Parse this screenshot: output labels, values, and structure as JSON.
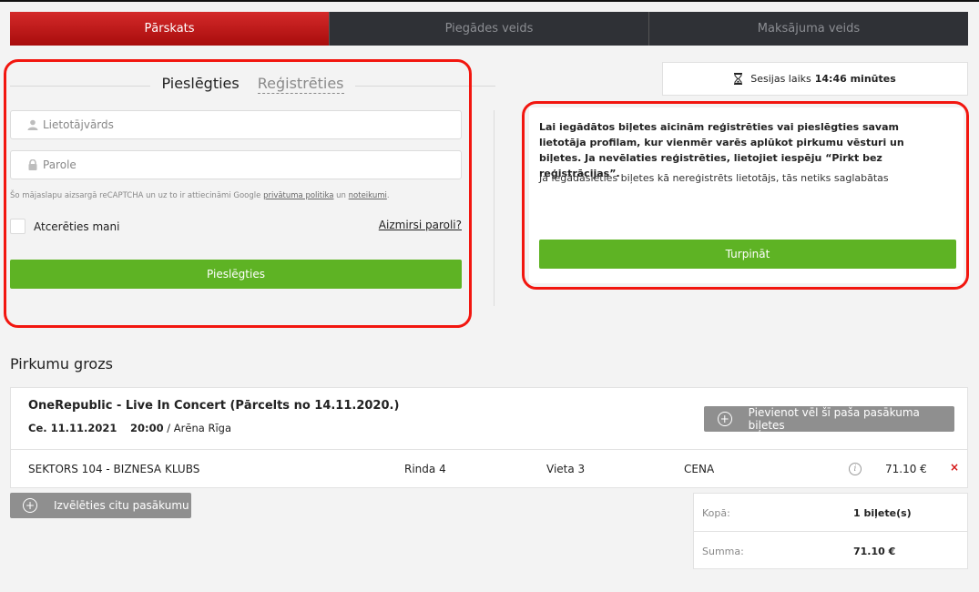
{
  "steps": [
    {
      "label": "Pārskats",
      "active": true
    },
    {
      "label": "Piegādes veids",
      "active": false
    },
    {
      "label": "Maksājuma veids",
      "active": false
    }
  ],
  "login": {
    "tab_login": "Pieslēgties",
    "tab_register": "Reģistrēties",
    "username_placeholder": "Lietotājvārds",
    "password_placeholder": "Parole",
    "recaptcha_text": "Šo mājaslapu aizsargā reCAPTCHA un uz to ir attiecināmi Google",
    "privacy_link": "privātuma politika",
    "and_text": "un",
    "terms_link": "noteikumi",
    "period": ".",
    "remember_label": "Atcerēties mani",
    "forgot_link": "Aizmirsi paroli?",
    "login_button": "Pieslēgties"
  },
  "session": {
    "label": "Sesijas laiks",
    "time": "14:46 minūtes",
    "icon": "hourglass-icon"
  },
  "info": {
    "bold_text": "Lai iegādātos biļetes aicinām reģistrēties vai pieslēgties savam lietotāja profilam, kur vienmēr varēs aplūkot pirkumu vēsturi un biļetes. Ja nevēlaties reģistrēties, lietojiet iespēju “Pirkt bez reģistrācijas”.",
    "normal_text": "Ja iegādāsieties biļetes kā nereģistrēts lietotājs, tās netiks saglabātas",
    "continue_button": "Turpināt"
  },
  "cart": {
    "title": "Pirkumu grozs",
    "event": {
      "name": "OneRepublic - Live In Concert (Pārcelts no 14.11.2020.)",
      "date": "Ce. 11.11.2021",
      "time": "20:00",
      "venue": "/ Arēna Rīga",
      "add_button": "Pievienot vēl šī paša pasākuma biļetes"
    },
    "tickets": [
      {
        "sector": "SEKTORS 104 - BIZNESA KLUBS",
        "row": "Rinda 4",
        "seat": "Vieta 3",
        "price_label": "CENA",
        "price": "71.10 €",
        "remove": "×"
      }
    ],
    "other_event_button": "Izvēlēties citu pasākumu",
    "summary": {
      "total_label": "Kopā:",
      "total_value": "1 biļete(s)",
      "sum_label": "Summa:",
      "sum_value": "71.10 €"
    }
  },
  "colors": {
    "active_step": "#c51a1a",
    "inactive_step": "#2f3136",
    "green_button": "#5eb324",
    "gray_button": "#8f8f8f",
    "annotation": "#f2160f"
  }
}
